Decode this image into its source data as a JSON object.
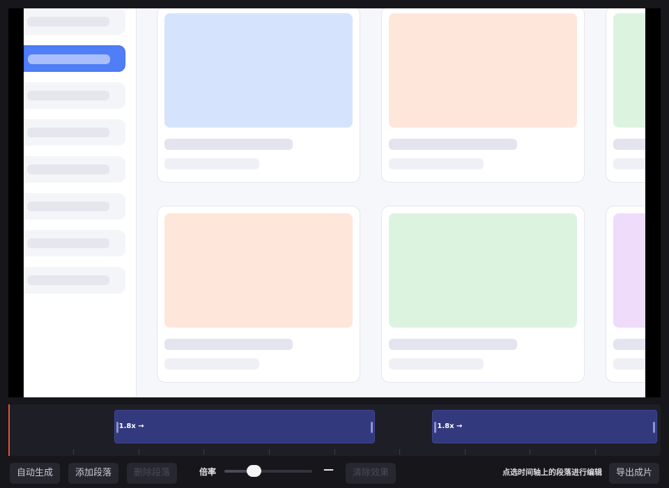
{
  "timeline": {
    "segments": [
      {
        "label": "1.8x →",
        "start_fraction": 0.162,
        "end_fraction": 0.562
      },
      {
        "label": "1.8x →",
        "start_fraction": 0.65,
        "end_fraction": 0.995
      }
    ],
    "playhead_fraction": 0.0
  },
  "toolbar": {
    "auto_generate": "自动生成",
    "add_segment": "添加段落",
    "delete_segment": "删除段落",
    "rate_label": "倍率",
    "rate_slider_fraction": 0.3,
    "rate_value": "—",
    "clear_effects": "清除效果",
    "hint": "点选时间轴上的段落进行编辑",
    "export": "导出成片"
  },
  "preview": {
    "card_thumb_colors": [
      "#d6e3fd",
      "#ffe6da",
      "#dcf3e0",
      "#ffe6da",
      "#dcf3e0",
      "#efdcfb"
    ]
  }
}
